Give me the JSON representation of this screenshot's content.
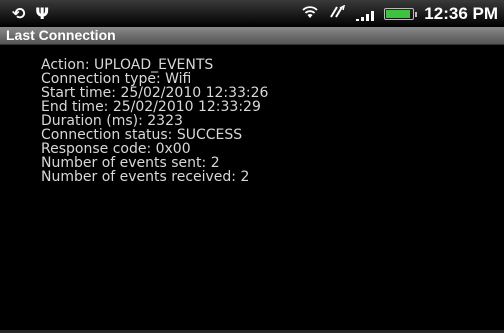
{
  "status_bar": {
    "icons_left": [
      "sync-icon",
      "usb-icon"
    ],
    "icons_right": [
      "wifi-icon",
      "data-icon",
      "signal-icon",
      "battery-icon"
    ],
    "battery_level": 0.9,
    "battery_color": "#3fc23f",
    "time": "12:36 PM"
  },
  "title_bar": {
    "title": "Last Connection"
  },
  "details": {
    "lines": [
      "Action: UPLOAD_EVENTS",
      "Connection type: Wifi",
      "Start time: 25/02/2010 12:33:26",
      "End time: 25/02/2010 12:33:29",
      "Duration (ms): 2323",
      "Connection status: SUCCESS",
      "Response code: 0x00",
      "Number of events sent: 2",
      "Number of events received: 2"
    ]
  }
}
